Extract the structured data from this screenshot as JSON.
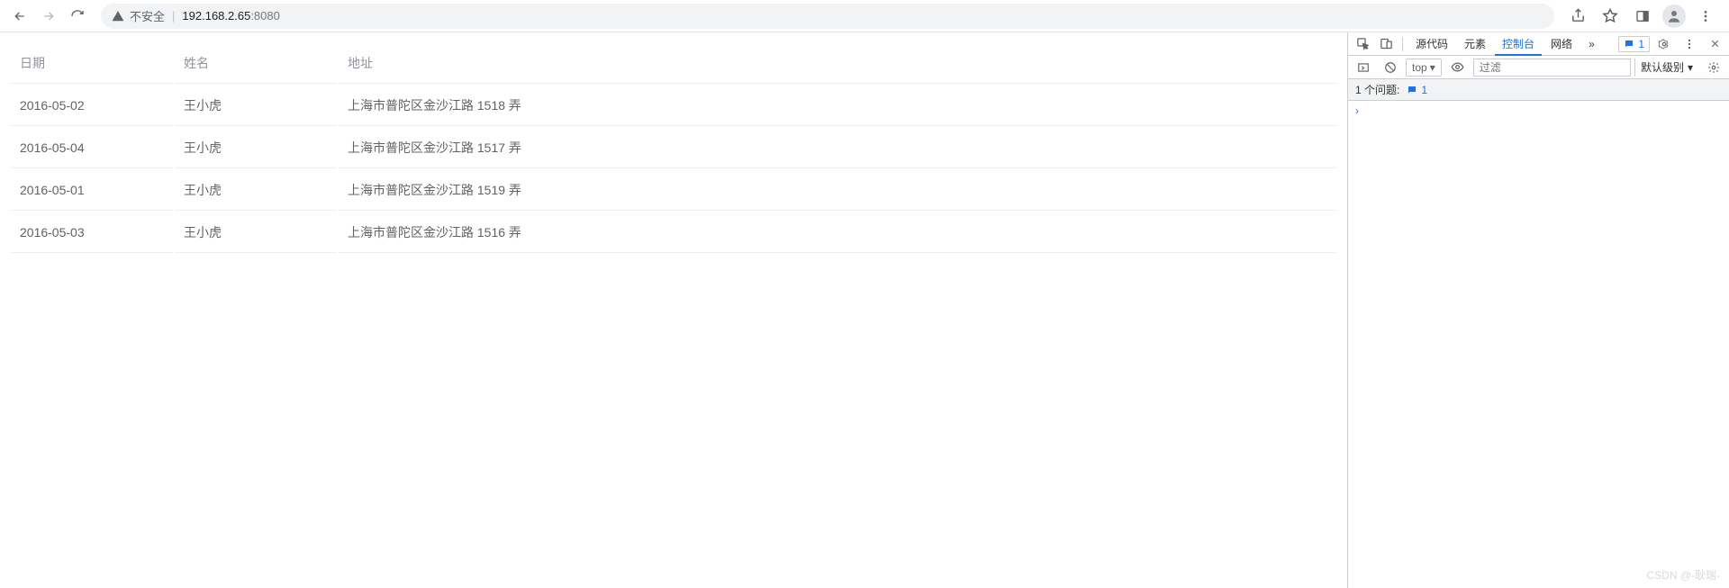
{
  "browser": {
    "security_label": "不安全",
    "host": "192.168.2.65",
    "port": ":8080"
  },
  "table": {
    "headers": {
      "date": "日期",
      "name": "姓名",
      "address": "地址"
    },
    "rows": [
      {
        "date": "2016-05-02",
        "name": "王小虎",
        "address": "上海市普陀区金沙江路 1518 弄"
      },
      {
        "date": "2016-05-04",
        "name": "王小虎",
        "address": "上海市普陀区金沙江路 1517 弄"
      },
      {
        "date": "2016-05-01",
        "name": "王小虎",
        "address": "上海市普陀区金沙江路 1519 弄"
      },
      {
        "date": "2016-05-03",
        "name": "王小虎",
        "address": "上海市普陀区金沙江路 1516 弄"
      }
    ]
  },
  "devtools": {
    "tabs": {
      "sources": "源代码",
      "elements": "元素",
      "console": "控制台",
      "network": "网络"
    },
    "issues_badge": "1",
    "more_tabs": "»",
    "toolbar": {
      "context": "top",
      "filter_placeholder": "过滤",
      "level": "默认级别"
    },
    "issues_row": {
      "label": "1 个问题:",
      "count": "1"
    },
    "console_prompt": "›"
  },
  "watermark": "CSDN @-耿瑞-"
}
